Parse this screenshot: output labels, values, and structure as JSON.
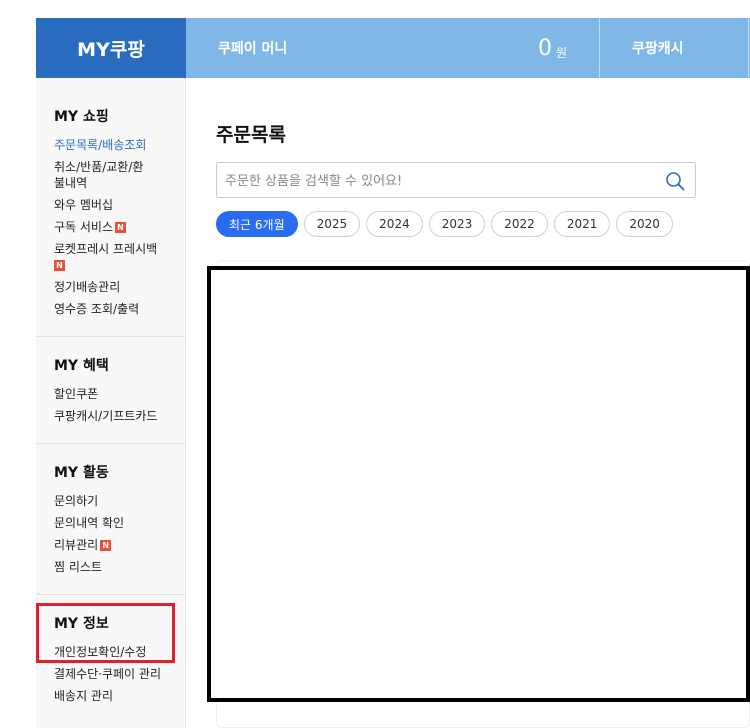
{
  "header": {
    "brand": "MY쿠팡",
    "coupay_label": "쿠페이 머니",
    "money_amount": "0",
    "money_unit": "원",
    "cash_label": "쿠팡캐시"
  },
  "sidebar": {
    "shopping": {
      "title": "MY 쇼핑",
      "items": [
        {
          "label": "주문목록/배송조회"
        },
        {
          "label": "취소/반품/교환/환불내역"
        },
        {
          "label": "와우 멤버십"
        },
        {
          "label": "구독 서비스"
        },
        {
          "label": "로켓프레시 프레시백"
        },
        {
          "label": "정기배송관리"
        },
        {
          "label": "영수증 조회/출력"
        }
      ]
    },
    "benefits": {
      "title": "MY 혜택",
      "items": [
        {
          "label": "할인쿠폰"
        },
        {
          "label": "쿠팡캐시/기프트카드"
        }
      ]
    },
    "activity": {
      "title": "MY 활동",
      "items": [
        {
          "label": "문의하기"
        },
        {
          "label": "문의내역 확인"
        },
        {
          "label": "리뷰관리"
        },
        {
          "label": "찜 리스트"
        }
      ]
    },
    "info": {
      "title": "MY 정보",
      "items": [
        {
          "label": "개인정보확인/수정"
        },
        {
          "label": "결제수단·쿠페이 관리"
        },
        {
          "label": "배송지 관리"
        }
      ]
    },
    "new_badge": "N"
  },
  "main": {
    "title": "주문목록",
    "search_placeholder": "주문한 상품을 검색할 수 있어요!",
    "chips": [
      "최근 6개월",
      "2025",
      "2024",
      "2023",
      "2022",
      "2021",
      "2020"
    ]
  },
  "colors": {
    "brand": "#2a6cc0",
    "header": "#7fb8e6",
    "active_chip": "#2a6cf0",
    "highlight": "#e0202a",
    "new_badge": "#e8503a"
  }
}
